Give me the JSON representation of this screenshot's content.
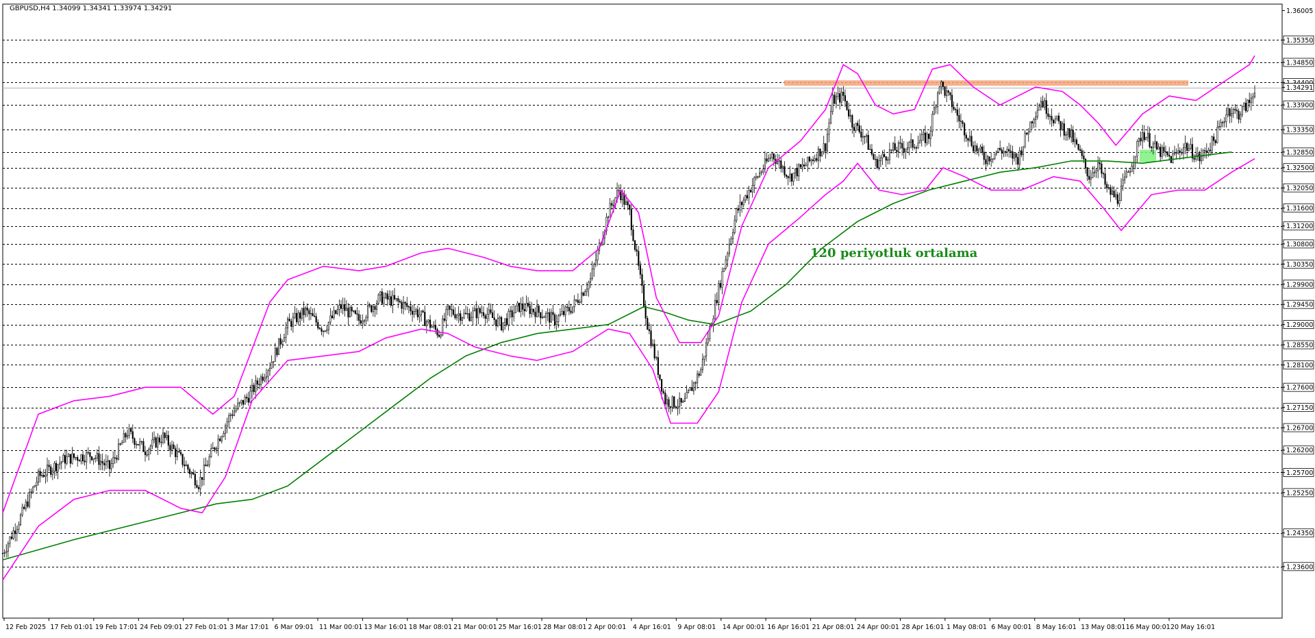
{
  "header": {
    "symbol_line": "GBPUSD,H4  1.34099 1.34341 1.33974 1.34291"
  },
  "colors": {
    "background": "#ffffff",
    "candle": "#000000",
    "bollinger": "#ff00ff",
    "moving_average": "#008000",
    "grid": "#000000",
    "resistance_zone": "#f4a57a",
    "support_box": "#7cf07c",
    "annotation": "#1a8a1a"
  },
  "chart_data": {
    "type": "candlestick",
    "symbol": "GBPUSD",
    "timeframe": "H4",
    "last_quote": {
      "open": 1.34099,
      "high": 1.34341,
      "low": 1.33974,
      "close": 1.34291
    },
    "y_range": [
      1.2245,
      1.3615
    ],
    "price_axis_labels": [
      "1.36005",
      "1.35350",
      "1.34850",
      "1.34400",
      "1.34291",
      "1.33900",
      "1.33350",
      "1.32850",
      "1.32500",
      "1.32050",
      "1.31600",
      "1.31200",
      "1.30800",
      "1.30350",
      "1.29900",
      "1.29450",
      "1.29000",
      "1.28550",
      "1.28100",
      "1.27600",
      "1.27150",
      "1.26700",
      "1.26200",
      "1.25700",
      "1.25250",
      "1.24350",
      "1.23600"
    ],
    "horizontal_levels": [
      1.3535,
      1.3485,
      1.344,
      1.339,
      1.3335,
      1.3285,
      1.325,
      1.3205,
      1.316,
      1.312,
      1.308,
      1.3035,
      1.299,
      1.2945,
      1.29,
      1.2855,
      1.281,
      1.276,
      1.2715,
      1.267,
      1.262,
      1.257,
      1.2525,
      1.2435,
      1.236
    ],
    "time_labels": [
      "12 Feb 2025",
      "17 Feb 01:01",
      "19 Feb 17:01",
      "24 Feb 09:01",
      "27 Feb 01:01",
      "3 Mar 17:01",
      "6 Mar 09:01",
      "11 Mar 00:01",
      "13 Mar 16:01",
      "18 Mar 08:01",
      "21 Mar 00:01",
      "25 Mar 16:01",
      "28 Mar 08:01",
      "2 Apr 00:01",
      "4 Apr 16:01",
      "9 Apr 08:01",
      "14 Apr 00:01",
      "16 Apr 16:01",
      "21 Apr 08:01",
      "24 Apr 00:01",
      "28 Apr 16:01",
      "1 May 08:01",
      "6 May 00:01",
      "8 May 16:01",
      "13 May 08:01",
      "16 May 00:01",
      "20 May 16:01"
    ],
    "price_path": [
      [
        0,
        1.239
      ],
      [
        10,
        1.247
      ],
      [
        20,
        1.256
      ],
      [
        35,
        1.26
      ],
      [
        50,
        1.261
      ],
      [
        60,
        1.258
      ],
      [
        70,
        1.266
      ],
      [
        80,
        1.262
      ],
      [
        90,
        1.265
      ],
      [
        100,
        1.26
      ],
      [
        110,
        1.2545
      ],
      [
        118,
        1.262
      ],
      [
        128,
        1.27
      ],
      [
        138,
        1.274
      ],
      [
        150,
        1.281
      ],
      [
        160,
        1.29
      ],
      [
        170,
        1.293
      ],
      [
        180,
        1.289
      ],
      [
        190,
        1.294
      ],
      [
        200,
        1.291
      ],
      [
        212,
        1.296
      ],
      [
        222,
        1.295
      ],
      [
        232,
        1.293
      ],
      [
        245,
        1.288
      ],
      [
        250,
        1.293
      ],
      [
        260,
        1.292
      ],
      [
        270,
        1.293
      ],
      [
        280,
        1.29
      ],
      [
        290,
        1.294
      ],
      [
        300,
        1.293
      ],
      [
        310,
        1.291
      ],
      [
        320,
        1.294
      ],
      [
        330,
        1.3
      ],
      [
        340,
        1.315
      ],
      [
        346,
        1.32
      ],
      [
        352,
        1.315
      ],
      [
        362,
        1.29
      ],
      [
        372,
        1.273
      ],
      [
        382,
        1.272
      ],
      [
        392,
        1.28
      ],
      [
        402,
        1.298
      ],
      [
        412,
        1.315
      ],
      [
        422,
        1.322
      ],
      [
        432,
        1.328
      ],
      [
        442,
        1.323
      ],
      [
        452,
        1.326
      ],
      [
        462,
        1.33
      ],
      [
        466,
        1.34
      ],
      [
        472,
        1.341
      ],
      [
        477,
        1.335
      ],
      [
        484,
        1.332
      ],
      [
        490,
        1.326
      ],
      [
        500,
        1.329
      ],
      [
        510,
        1.33
      ],
      [
        520,
        1.332
      ],
      [
        526,
        1.344
      ],
      [
        532,
        1.34
      ],
      [
        538,
        1.335
      ],
      [
        545,
        1.33
      ],
      [
        552,
        1.327
      ],
      [
        560,
        1.329
      ],
      [
        570,
        1.327
      ],
      [
        578,
        1.336
      ],
      [
        583,
        1.34
      ],
      [
        590,
        1.336
      ],
      [
        595,
        1.334
      ],
      [
        600,
        1.332
      ],
      [
        605,
        1.328
      ],
      [
        610,
        1.323
      ],
      [
        615,
        1.326
      ],
      [
        620,
        1.32
      ],
      [
        626,
        1.318
      ],
      [
        632,
        1.324
      ],
      [
        640,
        1.333
      ],
      [
        648,
        1.329
      ],
      [
        656,
        1.327
      ],
      [
        664,
        1.33
      ],
      [
        672,
        1.327
      ],
      [
        680,
        1.331
      ],
      [
        688,
        1.338
      ],
      [
        694,
        1.337
      ],
      [
        700,
        1.3395
      ],
      [
        703,
        1.3429
      ]
    ],
    "series": [
      {
        "name": "120 periyotluk ortalama",
        "points": [
          [
            0,
            1.2375
          ],
          [
            40,
            1.242
          ],
          [
            80,
            1.246
          ],
          [
            120,
            1.25
          ],
          [
            140,
            1.251
          ],
          [
            160,
            1.254
          ],
          [
            180,
            1.26
          ],
          [
            200,
            1.266
          ],
          [
            220,
            1.272
          ],
          [
            240,
            1.278
          ],
          [
            260,
            1.283
          ],
          [
            280,
            1.286
          ],
          [
            300,
            1.288
          ],
          [
            320,
            1.289
          ],
          [
            340,
            1.29
          ],
          [
            360,
            1.294
          ],
          [
            370,
            1.293
          ],
          [
            385,
            1.291
          ],
          [
            400,
            1.29
          ],
          [
            420,
            1.293
          ],
          [
            440,
            1.299
          ],
          [
            460,
            1.307
          ],
          [
            480,
            1.313
          ],
          [
            500,
            1.317
          ],
          [
            520,
            1.32
          ],
          [
            540,
            1.322
          ],
          [
            560,
            1.324
          ],
          [
            580,
            1.325
          ],
          [
            600,
            1.3265
          ],
          [
            620,
            1.3265
          ],
          [
            640,
            1.326
          ],
          [
            660,
            1.327
          ],
          [
            680,
            1.328
          ],
          [
            690,
            1.3285
          ]
        ]
      },
      {
        "name": "Bollinger upper",
        "points": [
          [
            0,
            1.248
          ],
          [
            20,
            1.27
          ],
          [
            40,
            1.273
          ],
          [
            60,
            1.274
          ],
          [
            80,
            1.276
          ],
          [
            100,
            1.276
          ],
          [
            118,
            1.27
          ],
          [
            130,
            1.274
          ],
          [
            150,
            1.295
          ],
          [
            160,
            1.3
          ],
          [
            180,
            1.303
          ],
          [
            200,
            1.302
          ],
          [
            215,
            1.303
          ],
          [
            235,
            1.306
          ],
          [
            250,
            1.307
          ],
          [
            270,
            1.305
          ],
          [
            285,
            1.303
          ],
          [
            300,
            1.302
          ],
          [
            320,
            1.302
          ],
          [
            335,
            1.307
          ],
          [
            347,
            1.32
          ],
          [
            357,
            1.315
          ],
          [
            367,
            1.296
          ],
          [
            380,
            1.286
          ],
          [
            392,
            1.286
          ],
          [
            402,
            1.292
          ],
          [
            415,
            1.312
          ],
          [
            430,
            1.325
          ],
          [
            448,
            1.331
          ],
          [
            462,
            1.338
          ],
          [
            472,
            1.348
          ],
          [
            480,
            1.346
          ],
          [
            490,
            1.339
          ],
          [
            500,
            1.337
          ],
          [
            512,
            1.338
          ],
          [
            522,
            1.347
          ],
          [
            532,
            1.348
          ],
          [
            545,
            1.343
          ],
          [
            560,
            1.339
          ],
          [
            580,
            1.343
          ],
          [
            595,
            1.342
          ],
          [
            605,
            1.339
          ],
          [
            615,
            1.335
          ],
          [
            625,
            1.33
          ],
          [
            640,
            1.337
          ],
          [
            655,
            1.341
          ],
          [
            670,
            1.34
          ],
          [
            685,
            1.344
          ],
          [
            700,
            1.348
          ],
          [
            703,
            1.35
          ]
        ]
      },
      {
        "name": "Bollinger lower",
        "points": [
          [
            0,
            1.233
          ],
          [
            20,
            1.245
          ],
          [
            40,
            1.251
          ],
          [
            60,
            1.253
          ],
          [
            80,
            1.253
          ],
          [
            100,
            1.249
          ],
          [
            112,
            1.248
          ],
          [
            125,
            1.256
          ],
          [
            140,
            1.273
          ],
          [
            160,
            1.282
          ],
          [
            180,
            1.283
          ],
          [
            200,
            1.284
          ],
          [
            215,
            1.287
          ],
          [
            235,
            1.289
          ],
          [
            250,
            1.288
          ],
          [
            265,
            1.285
          ],
          [
            285,
            1.283
          ],
          [
            300,
            1.282
          ],
          [
            320,
            1.284
          ],
          [
            340,
            1.289
          ],
          [
            352,
            1.288
          ],
          [
            365,
            1.28
          ],
          [
            375,
            1.268
          ],
          [
            390,
            1.268
          ],
          [
            402,
            1.275
          ],
          [
            415,
            1.295
          ],
          [
            430,
            1.308
          ],
          [
            448,
            1.314
          ],
          [
            462,
            1.319
          ],
          [
            472,
            1.322
          ],
          [
            480,
            1.326
          ],
          [
            492,
            1.32
          ],
          [
            505,
            1.319
          ],
          [
            518,
            1.32
          ],
          [
            528,
            1.325
          ],
          [
            540,
            1.323
          ],
          [
            555,
            1.32
          ],
          [
            572,
            1.32
          ],
          [
            590,
            1.323
          ],
          [
            605,
            1.322
          ],
          [
            618,
            1.316
          ],
          [
            628,
            1.311
          ],
          [
            645,
            1.319
          ],
          [
            660,
            1.32
          ],
          [
            675,
            1.32
          ],
          [
            690,
            1.324
          ],
          [
            703,
            1.327
          ]
        ]
      }
    ],
    "annotations": {
      "ma_label": "120 periyotluk ortalama",
      "resistance_zone": {
        "from": 1.3435,
        "to": 1.3445
      },
      "support_box": {
        "from": 1.327,
        "to": 1.329
      }
    },
    "grid": true
  }
}
